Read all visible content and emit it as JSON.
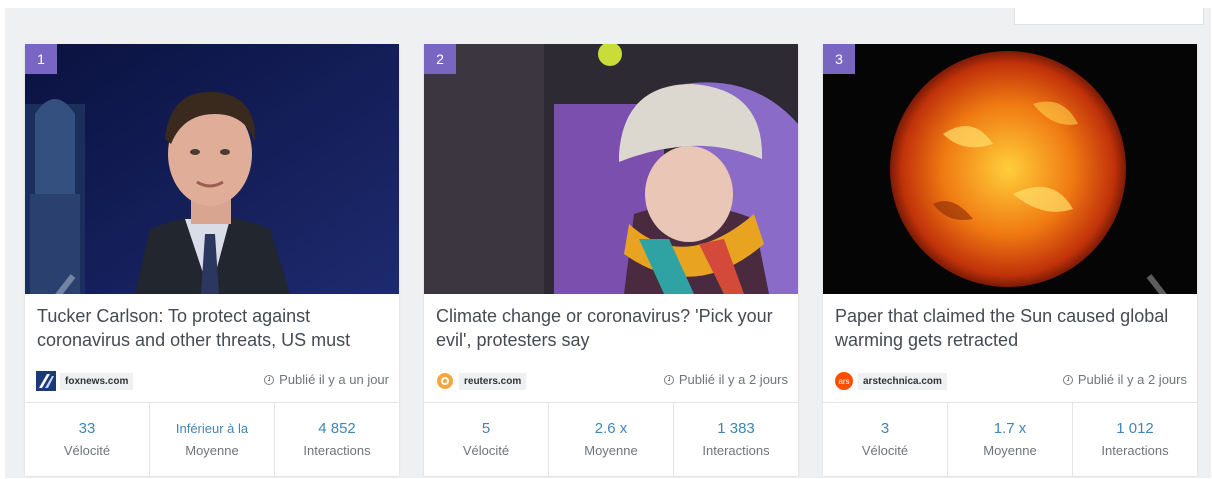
{
  "cards": [
    {
      "rank": "1",
      "title": "Tucker Carlson: To protect against coronavirus and other threats, US must",
      "source": "foxnews.com",
      "published": "Publié il y a un jour",
      "stats": [
        {
          "value": "33",
          "label": "Vélocité"
        },
        {
          "value": "Inférieur à la",
          "label": "Moyenne"
        },
        {
          "value": "4 852",
          "label": "Interactions"
        }
      ]
    },
    {
      "rank": "2",
      "title": "Climate change or coronavirus? 'Pick your evil', protesters say",
      "source": "reuters.com",
      "published": "Publié il y a 2 jours",
      "stats": [
        {
          "value": "5",
          "label": "Vélocité"
        },
        {
          "value": "2.6 x",
          "label": "Moyenne"
        },
        {
          "value": "1 383",
          "label": "Interactions"
        }
      ]
    },
    {
      "rank": "3",
      "title": "Paper that claimed the Sun caused global warming gets retracted",
      "source": "arstechnica.com",
      "published": "Publié il y a 2 jours",
      "stats": [
        {
          "value": "3",
          "label": "Vélocité"
        },
        {
          "value": "1.7 x",
          "label": "Moyenne"
        },
        {
          "value": "1 012",
          "label": "Interactions"
        }
      ]
    }
  ],
  "colors": {
    "rank_badge": "#7966c2",
    "stat_value": "#3f86b8",
    "background": "#eef0f1"
  },
  "icons": {
    "prev": "chevron-left-icon",
    "next": "chevron-right-icon",
    "clock": "clock-icon"
  }
}
